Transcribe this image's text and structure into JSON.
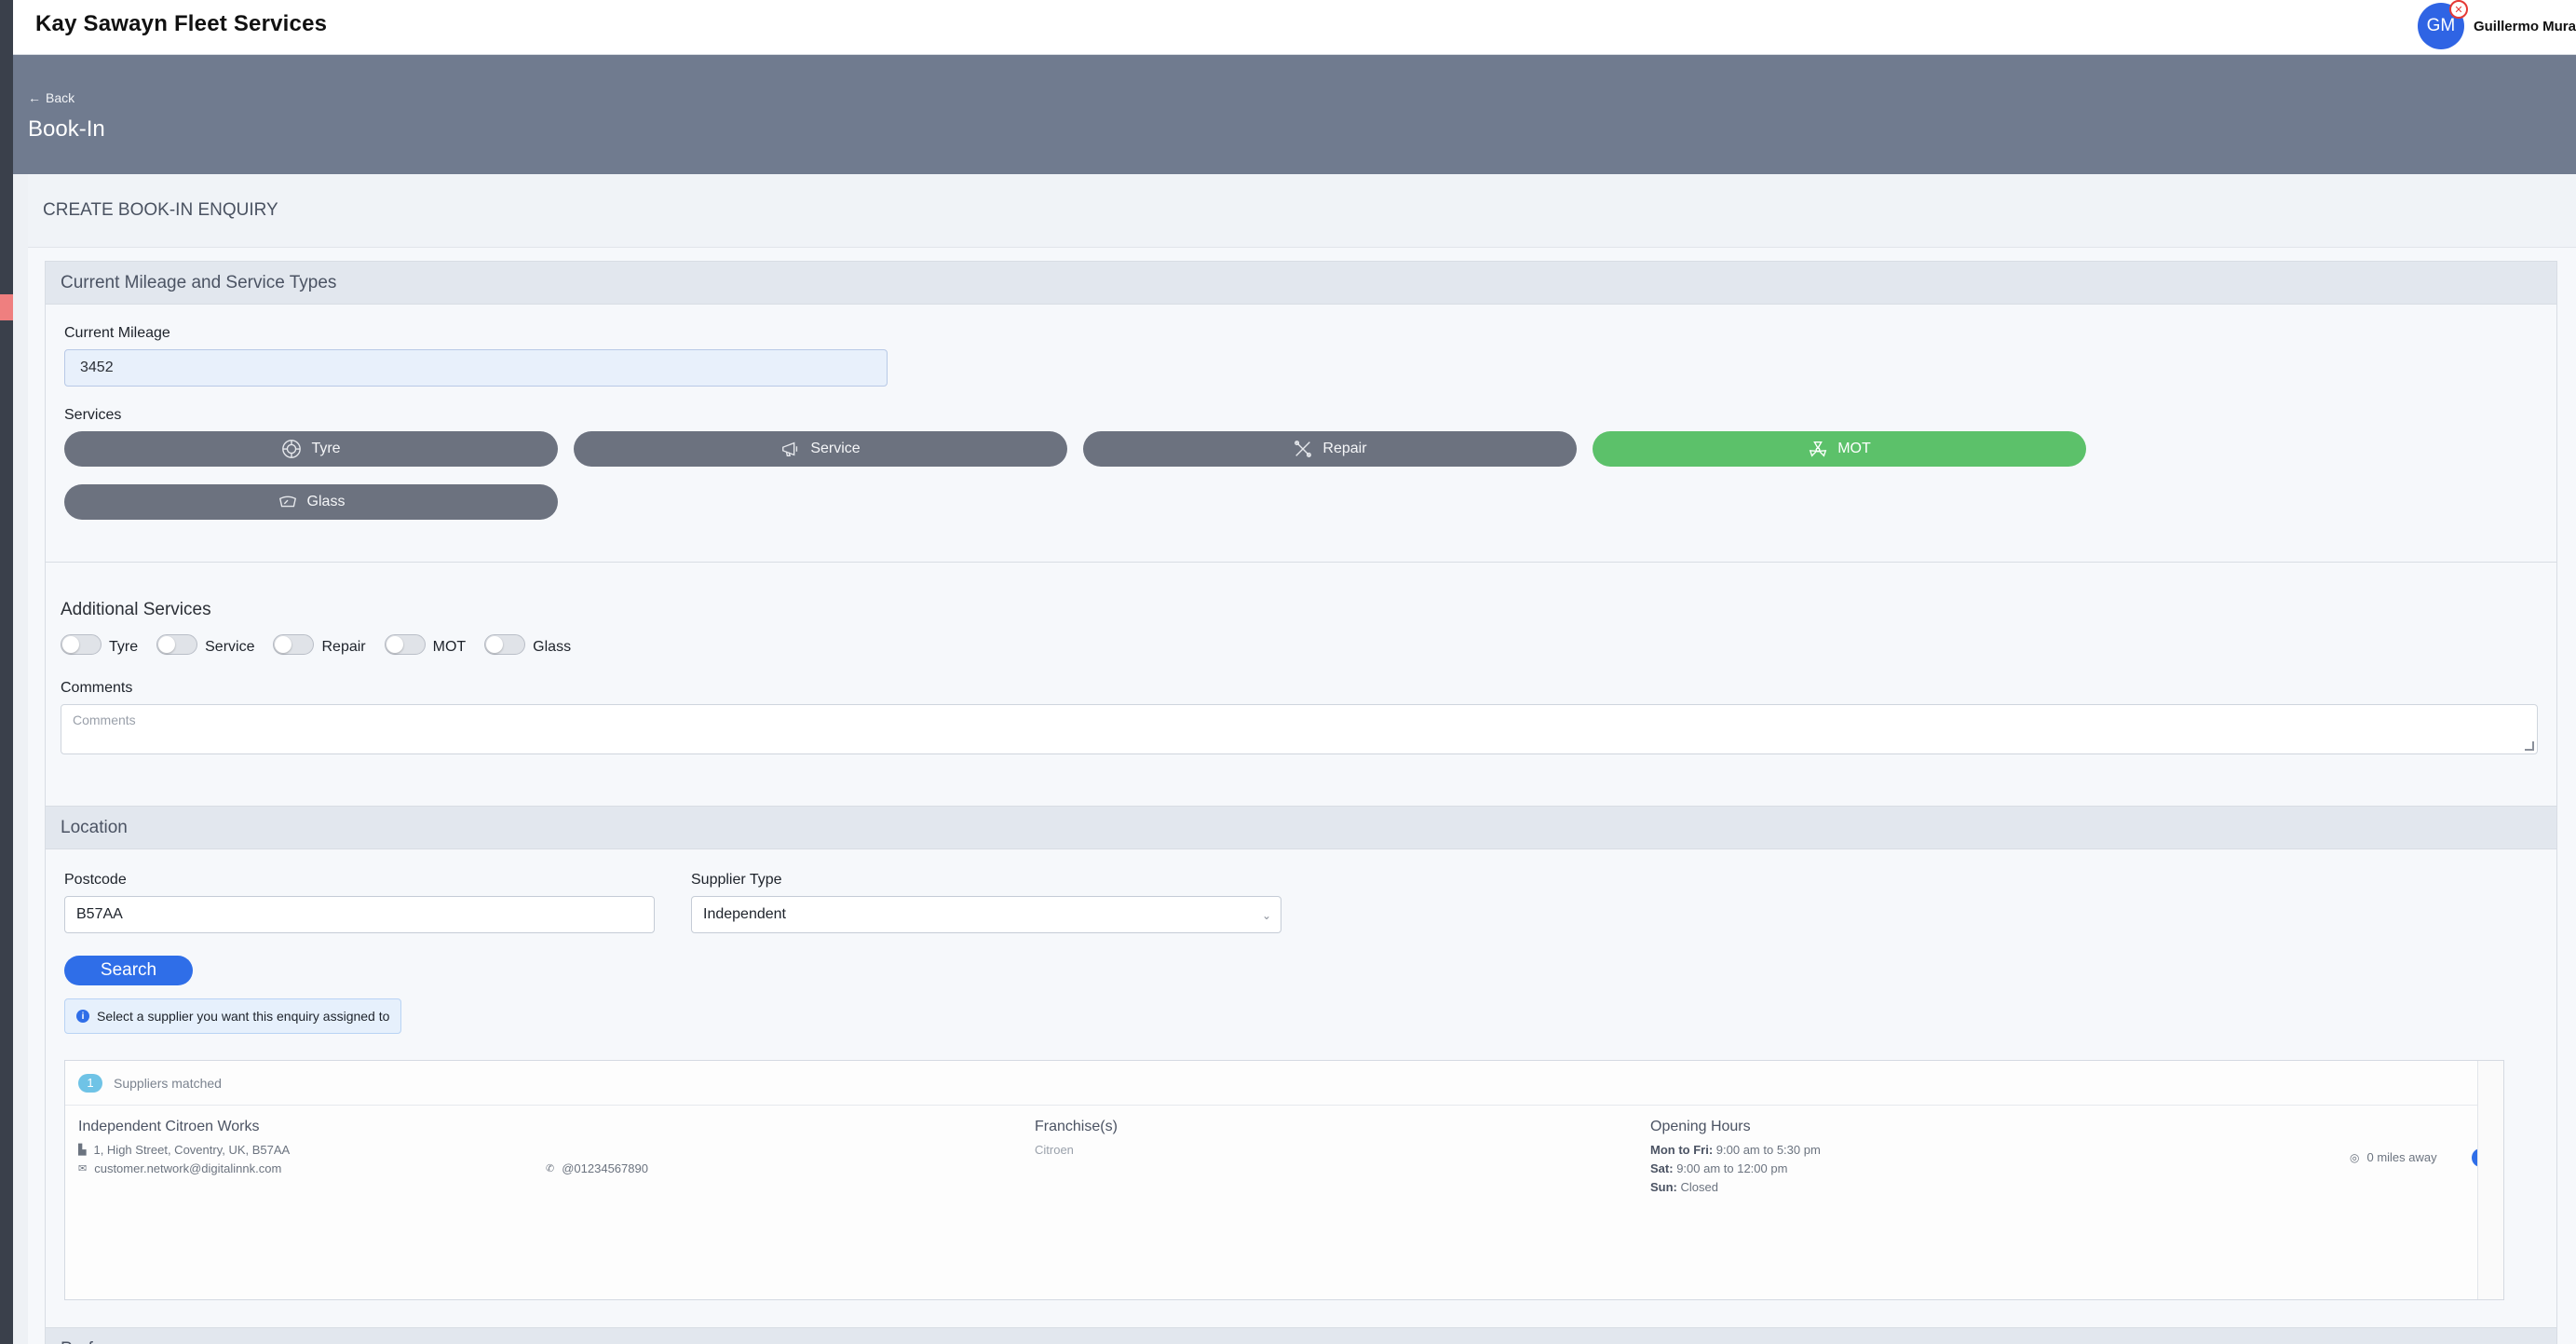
{
  "app": {
    "brand": "Kay Sawayn Fleet Services"
  },
  "user": {
    "initials": "GM",
    "name": "Guillermo Mura"
  },
  "header": {
    "back_label": "Back",
    "title": "Book-In"
  },
  "card": {
    "title": "CREATE BOOK-IN ENQUIRY"
  },
  "mileage_section": {
    "title": "Current Mileage and Service Types",
    "mileage_label": "Current Mileage",
    "mileage_value": "3452",
    "services_label": "Services",
    "services": [
      {
        "label": "Tyre",
        "icon": "tyre-icon",
        "active": false
      },
      {
        "label": "Service",
        "icon": "megaphone-icon",
        "active": false
      },
      {
        "label": "Repair",
        "icon": "tools-icon",
        "active": false
      },
      {
        "label": "MOT",
        "icon": "radiation-icon",
        "active": true
      },
      {
        "label": "Glass",
        "icon": "windscreen-icon",
        "active": false
      }
    ],
    "active_color": "#5cc16a",
    "inactive_color": "#6c727f"
  },
  "additional": {
    "title": "Additional Services",
    "toggles": [
      {
        "label": "Tyre",
        "on": false
      },
      {
        "label": "Service",
        "on": false
      },
      {
        "label": "Repair",
        "on": false
      },
      {
        "label": "MOT",
        "on": false
      },
      {
        "label": "Glass",
        "on": false
      }
    ],
    "comments_label": "Comments",
    "comments_placeholder": "Comments"
  },
  "location": {
    "title": "Location",
    "postcode_label": "Postcode",
    "postcode_value": "B57AA",
    "supplier_type_label": "Supplier Type",
    "supplier_type_value": "Independent",
    "search_label": "Search",
    "hint": "Select a supplier you want this enquiry assigned to"
  },
  "results": {
    "count": "1",
    "count_label": "Suppliers matched",
    "suppliers": [
      {
        "name": "Independent Citroen Works",
        "address": "1, High Street, Coventry, UK, B57AA",
        "email": "customer.network@digitalinnk.com",
        "phone": "@01234567890",
        "franchise_label": "Franchise(s)",
        "franchise": "Citroen",
        "hours_label": "Opening Hours",
        "hours": [
          {
            "day": "Mon to Fri:",
            "time": "9:00 am to 5:30 pm"
          },
          {
            "day": "Sat:",
            "time": "9:00 am to 12:00 pm"
          },
          {
            "day": "Sun:",
            "time": "Closed"
          }
        ],
        "distance": "0 miles away"
      }
    ]
  },
  "next_section": {
    "title": "Pref"
  }
}
